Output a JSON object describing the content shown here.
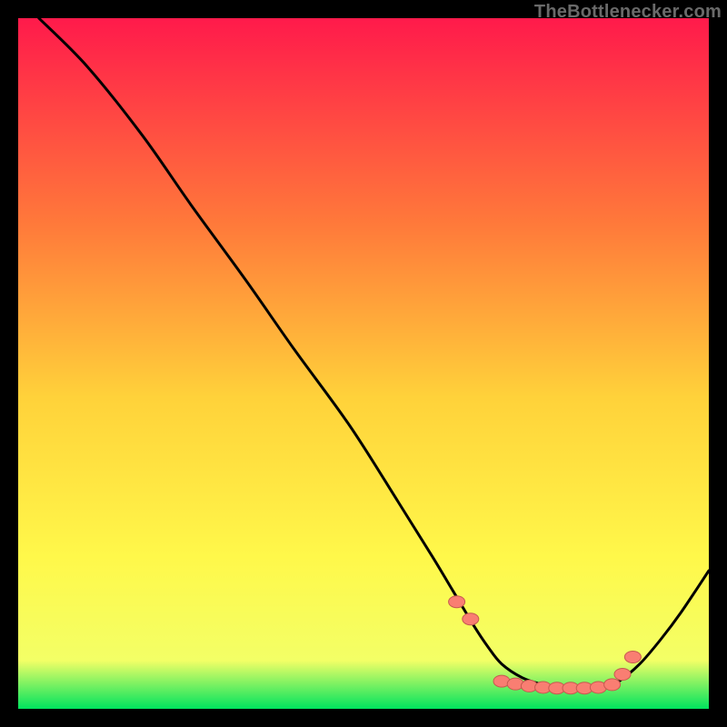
{
  "watermark": "TheBottlenecker.com",
  "colors": {
    "gradient_top": "#ff1a4b",
    "gradient_mid_upper": "#ff7a3a",
    "gradient_mid": "#ffd23a",
    "gradient_mid_lower": "#fff84a",
    "gradient_bottom": "#00e35e",
    "curve": "#000000",
    "marker_fill": "#f97e72",
    "marker_stroke": "#c65a50"
  },
  "chart_data": {
    "type": "line",
    "xlabel": "",
    "ylabel": "",
    "xlim": [
      0,
      100
    ],
    "ylim": [
      0,
      100
    ],
    "curve": {
      "x": [
        3,
        10,
        18,
        25,
        33,
        40,
        48,
        55,
        60,
        63,
        66,
        68,
        70,
        73,
        76,
        79,
        82,
        85,
        87,
        90,
        93,
        96,
        100
      ],
      "y": [
        100,
        93,
        83,
        73,
        62,
        52,
        41,
        30,
        22,
        17,
        12,
        9,
        6.5,
        4.5,
        3.5,
        3.0,
        3.0,
        3.2,
        4.0,
        6.5,
        10,
        14,
        20
      ]
    },
    "markers": {
      "x": [
        63.5,
        65.5,
        70,
        72,
        74,
        76,
        78,
        80,
        82,
        84,
        86,
        87.5,
        89
      ],
      "y": [
        15.5,
        13.0,
        4.0,
        3.6,
        3.3,
        3.1,
        3.0,
        3.0,
        3.0,
        3.1,
        3.5,
        5.0,
        7.5
      ]
    }
  }
}
